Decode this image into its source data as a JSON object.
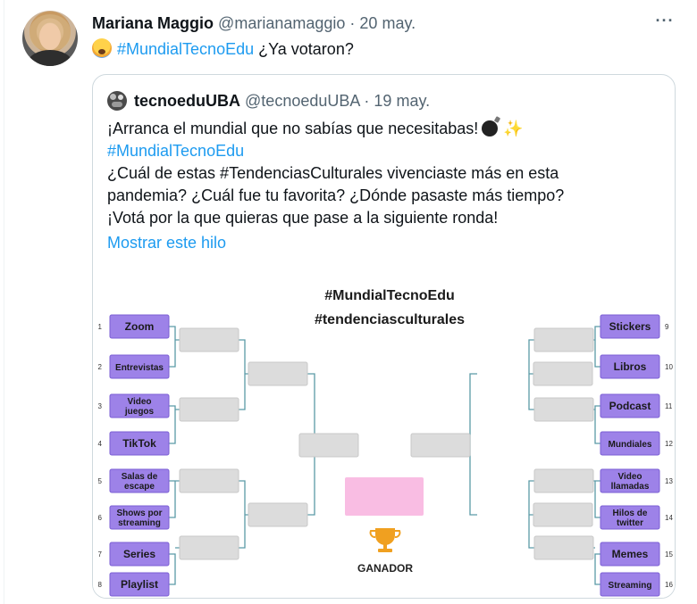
{
  "tweet": {
    "author_name": "Mariana Maggio",
    "author_handle": "@marianamaggio",
    "separator": "·",
    "date": "20 may.",
    "more_icon": "more-horizontal-icon",
    "hashtag": "#MundialTecnoEdu",
    "text_after": " ¿Ya votaron?"
  },
  "quote": {
    "author_name": "tecnoeduUBA",
    "author_handle": "@tecnoeduUBA",
    "separator": "·",
    "date": "19 may.",
    "lines": [
      "¡Arranca el mundial que no sabías que necesitabas!",
      "#MundialTecnoEdu",
      "¿Cuál de estas #TendenciasCulturales vivenciaste más en esta",
      "pandemia? ¿Cuál fue tu favorita? ¿Dónde pasaste más tiempo?",
      "¡Votá por la que quieras que pase a la siguiente ronda!"
    ],
    "show_thread": "Mostrar este hilo"
  },
  "bracket": {
    "title1": "#MundialTecnoEdu",
    "title2": "#tendenciasculturales",
    "winner_label": "GANADOR",
    "left": [
      {
        "num": "1",
        "l1": "Zoom",
        "l2": ""
      },
      {
        "num": "2",
        "l1": "Entrevistas",
        "l2": ""
      },
      {
        "num": "3",
        "l1": "Video",
        "l2": "juegos"
      },
      {
        "num": "4",
        "l1": "TikTok",
        "l2": ""
      },
      {
        "num": "5",
        "l1": "Salas de",
        "l2": "escape"
      },
      {
        "num": "6",
        "l1": "Shows por",
        "l2": "streaming"
      },
      {
        "num": "7",
        "l1": "Series",
        "l2": ""
      },
      {
        "num": "8",
        "l1": "Playlist",
        "l2": ""
      }
    ],
    "right": [
      {
        "num": "9",
        "l1": "Stickers",
        "l2": ""
      },
      {
        "num": "10",
        "l1": "Libros",
        "l2": ""
      },
      {
        "num": "11",
        "l1": "Podcast",
        "l2": ""
      },
      {
        "num": "12",
        "l1": "Mundiales",
        "l2": ""
      },
      {
        "num": "13",
        "l1": "Video",
        "l2": "llamadas"
      },
      {
        "num": "14",
        "l1": "Hilos de",
        "l2": "twitter"
      },
      {
        "num": "15",
        "l1": "Memes",
        "l2": ""
      },
      {
        "num": "16",
        "l1": "Streaming",
        "l2": ""
      }
    ],
    "colors": {
      "team_fill": "#9d82e8",
      "team_border": "#7b5fd4",
      "slot_fill": "#dcdcdc",
      "line": "#5a9aa6",
      "winner_fill": "#f9bde3",
      "trophy": "#f0a020"
    },
    "trophy_icon": "trophy-icon"
  }
}
